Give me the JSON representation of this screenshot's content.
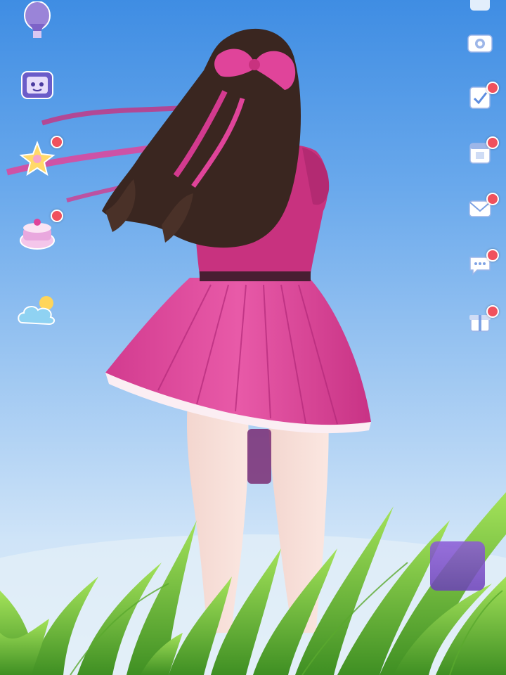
{
  "colors": {
    "sky_top": "#3f8de3",
    "sky_bottom": "#dcecf8",
    "skirt": "#e0449a",
    "top_shirt": "#c8327f",
    "hair": "#3a2620",
    "grass": "#7ccf3c",
    "badge": "#f0515d"
  },
  "top_hint": "",
  "left_buttons": [
    {
      "id": "balloon",
      "icon": "hot-air-balloon-icon",
      "label": "",
      "badge": false
    },
    {
      "id": "tv",
      "icon": "tv-robot-icon",
      "label": "",
      "badge": false
    },
    {
      "id": "fairy",
      "icon": "fairy-icon",
      "label": "",
      "badge": true
    },
    {
      "id": "cake",
      "icon": "cake-icon",
      "label": "",
      "badge": true
    },
    {
      "id": "cloud",
      "icon": "cloud-sun-icon",
      "label": "",
      "badge": false
    }
  ],
  "right_buttons": [
    {
      "id": "r1",
      "icon": "menu-icon",
      "label": "",
      "badge": false
    },
    {
      "id": "r2",
      "icon": "camera-icon",
      "label": "",
      "badge": false
    },
    {
      "id": "r3",
      "icon": "checklist-icon",
      "label": "",
      "badge": true
    },
    {
      "id": "r4",
      "icon": "calendar-icon",
      "label": "",
      "badge": true
    },
    {
      "id": "r5",
      "icon": "mail-icon",
      "label": "",
      "badge": true
    },
    {
      "id": "r6",
      "icon": "chat-icon",
      "label": "",
      "badge": true
    },
    {
      "id": "r7",
      "icon": "gift-icon",
      "label": "",
      "badge": true
    }
  ]
}
